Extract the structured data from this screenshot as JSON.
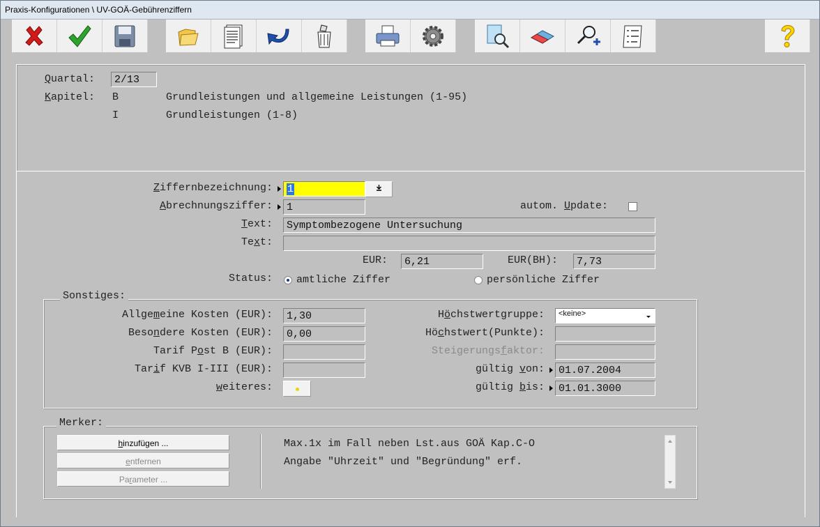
{
  "window": {
    "title": "Praxis-Konfigurationen \\ UV-GOÄ-Gebührenziffern"
  },
  "toolbar": {
    "buttons": [
      {
        "name": "cancel-icon"
      },
      {
        "name": "confirm-icon"
      },
      {
        "name": "save-icon"
      },
      {
        "name": "open-folder-icon"
      },
      {
        "name": "document-list-icon"
      },
      {
        "name": "undo-icon"
      },
      {
        "name": "trash-icon"
      },
      {
        "name": "print-icon"
      },
      {
        "name": "settings-gear-icon"
      },
      {
        "name": "search-document-icon"
      },
      {
        "name": "eraser-icon"
      },
      {
        "name": "zoom-add-icon"
      },
      {
        "name": "numbered-list-icon"
      },
      {
        "name": "help-icon"
      }
    ]
  },
  "header": {
    "quartal_label_u": "Q",
    "quartal_label_rest": "uartal:",
    "quartal_value": "2/13",
    "kapitel_label_u": "K",
    "kapitel_label_rest": "apitel:",
    "kapitel_code": "B",
    "kapitel_text": "Grundleistungen und allgemeine Leistungen (1-95)",
    "sub_code": "I",
    "sub_text": "Grundleistungen (1-8)"
  },
  "form": {
    "ziffer_label_u": "Z",
    "ziffer_label_rest": "iffernbezeichnung:",
    "ziffer_value": "1",
    "abrechnung_label_u": "A",
    "abrechnung_label_rest": "brechnungsziffer:",
    "abrechnung_value": "1",
    "autoupdate_label_pre": "autom. ",
    "autoupdate_label_u": "U",
    "autoupdate_label_rest": "pdate:",
    "text1_label_u": "T",
    "text1_label_rest": "ext:",
    "text1_value": "Symptombezogene Untersuchung",
    "text2_label_pre": "Te",
    "text2_label_u": "x",
    "text2_label_rest": "t:",
    "text2_value": "",
    "eur_label": "EUR:",
    "eur_value": "6,21",
    "eurbh_label": "EUR(BH):",
    "eurbh_value": "7,73",
    "status_label": "Status:",
    "status_opt1": "amtliche Ziffer",
    "status_opt2": "persönliche Ziffer"
  },
  "sonstiges": {
    "title": "Sonstiges:",
    "allg_pre": "Allge",
    "allg_u": "m",
    "allg_rest": "eine Kosten (EUR):",
    "allg_value": "1,30",
    "bes_pre": "Beso",
    "bes_u": "n",
    "bes_rest": "dere Kosten (EUR):",
    "bes_value": "0,00",
    "post_pre": "Tarif P",
    "post_u": "o",
    "post_rest": "st B (EUR):",
    "post_value": "",
    "kvb_pre": "Tar",
    "kvb_u": "i",
    "kvb_rest": "f KVB I-III (EUR):",
    "kvb_value": "",
    "weiteres_u": "w",
    "weiteres_rest": "eiteres:",
    "hwg_pre": "H",
    "hwg_u": "ö",
    "hwg_rest": "chstwertgruppe:",
    "hwg_value": "<keine>",
    "hw_pre": "Hö",
    "hw_u": "c",
    "hw_rest": "hstwert(Punkte):",
    "hw_value": "",
    "stf_pre": "Steigerungs",
    "stf_u": "f",
    "stf_rest": "aktor:",
    "stf_value": "",
    "von_pre": "gültig ",
    "von_u": "v",
    "von_rest": "on:",
    "von_value": "01.07.2004",
    "bis_pre": "gültig ",
    "bis_u": "b",
    "bis_rest": "is:",
    "bis_value": "01.01.3000"
  },
  "merker": {
    "title": "Merker:",
    "btn_add_u": "h",
    "btn_add_rest": "inzufügen ...",
    "btn_remove_u": "e",
    "btn_remove_rest": "ntfernen",
    "btn_params_pre": "Pa",
    "btn_params_u": "r",
    "btn_params_rest": "ameter ...",
    "line1": "Max.1x im Fall neben Lst.aus GOÄ Kap.C-O",
    "line2": "Angabe \"Uhrzeit\" und \"Begründung\" erf."
  }
}
